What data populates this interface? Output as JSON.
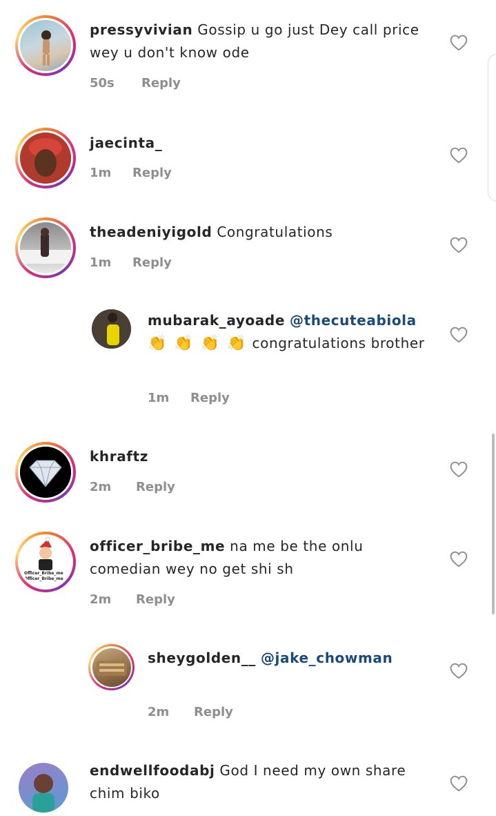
{
  "comments": [
    {
      "username": "pressyvivian",
      "text": "Gossip u go just Dey call price wey u don't know ode",
      "mention": "",
      "time": "50s",
      "reply_label": "Reply",
      "avatar": "beach-photo",
      "colors": [
        "#7fb2c8",
        "#d8c6b0"
      ]
    },
    {
      "username": "jaecinta_",
      "text": "",
      "mention": "",
      "time": "1m",
      "reply_label": "Reply",
      "avatar": "red-headwrap-portrait",
      "colors": [
        "#c0392b",
        "#5a3321"
      ]
    },
    {
      "username": "theadeniyigold",
      "text": "Congratulations",
      "mention": "",
      "time": "1m",
      "reply_label": "Reply",
      "avatar": "man-by-car-photo",
      "colors": [
        "#6b6b6b",
        "#e8e8e8"
      ]
    },
    {
      "username": "mubarak_ayoade",
      "text": "congratulations brother",
      "mention": "@thecuteabiola",
      "emoji": "👏 👏 👏 👏",
      "time": "1m",
      "reply_label": "Reply",
      "avatar": "man-yellow-photo",
      "colors": [
        "#3b3127",
        "#e8d400"
      ]
    },
    {
      "username": "khraftz",
      "text": "",
      "mention": "",
      "time": "2m",
      "reply_label": "Reply",
      "avatar": "diamond-logo",
      "colors": [
        "#000000",
        "#dfe6ee"
      ]
    },
    {
      "username": "officer_bribe_me",
      "text": "na me be the onlu comedian wey no get shi sh",
      "mention": "",
      "time": "2m",
      "reply_label": "Reply",
      "avatar": "cartoon-santa-logo",
      "colors": [
        "#ffffff",
        "#d32f2f"
      ],
      "avatar_caption_1": "Officer_Bribe_me",
      "avatar_caption_2": "Officer_Bribe_me"
    },
    {
      "username": "sheygolden__",
      "text": "",
      "mention": "@jake_chowman",
      "time": "2m",
      "reply_label": "Reply",
      "avatar": "food-photo",
      "colors": [
        "#b08a5a",
        "#6a4a2a"
      ]
    },
    {
      "username": "endwellfoodabj",
      "text": "God I need my own share chim biko",
      "mention": "",
      "time": "",
      "reply_label": "",
      "avatar": "woman-portrait-photo",
      "colors": [
        "#8e6bbf",
        "#5a9bd4"
      ]
    }
  ],
  "icons": {
    "like": "heart-outline-icon"
  }
}
